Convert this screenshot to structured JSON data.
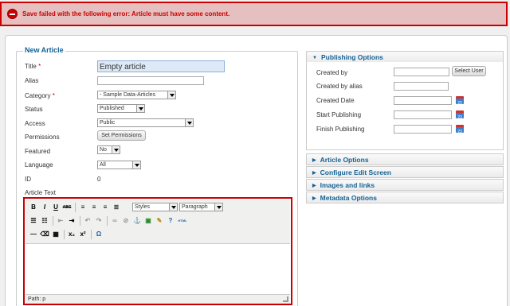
{
  "error": {
    "message": "Save failed with the following error: Article must have some content."
  },
  "form": {
    "legend": "New Article",
    "title_label": "Title",
    "title_value": "Empty article",
    "alias_label": "Alias",
    "alias_value": "",
    "category_label": "Category",
    "category_value": "- Sample Data-Articles",
    "status_label": "Status",
    "status_value": "Published",
    "access_label": "Access",
    "access_value": "Public",
    "permissions_label": "Permissions",
    "permissions_button": "Set Permissions",
    "featured_label": "Featured",
    "featured_value": "No",
    "language_label": "Language",
    "language_value": "All",
    "id_label": "ID",
    "id_value": "0",
    "article_text_label": "Article Text",
    "required_mark": "*"
  },
  "editor": {
    "styles_value": "Styles",
    "format_value": "Paragraph",
    "path_text": "Path: p",
    "html_icon": "HTML",
    "toolbar_row1": [
      "B",
      "I",
      "U",
      "ABC"
    ],
    "toolbar_row3_omega": "Ω"
  },
  "publishing": {
    "title": "Publishing Options",
    "created_by_label": "Created by",
    "created_by_value": "",
    "select_user_button": "Select User",
    "created_by_alias_label": "Created by alias",
    "created_date_label": "Created Date",
    "start_publishing_label": "Start Publishing",
    "finish_publishing_label": "Finish Publishing",
    "calendar_day": "23"
  },
  "panels": [
    "Article Options",
    "Configure Edit Screen",
    "Images and links",
    "Metadata Options"
  ],
  "colors": {
    "error_red": "#cc0000",
    "error_bg": "#e6c0c0",
    "heading_blue": "#146295"
  }
}
